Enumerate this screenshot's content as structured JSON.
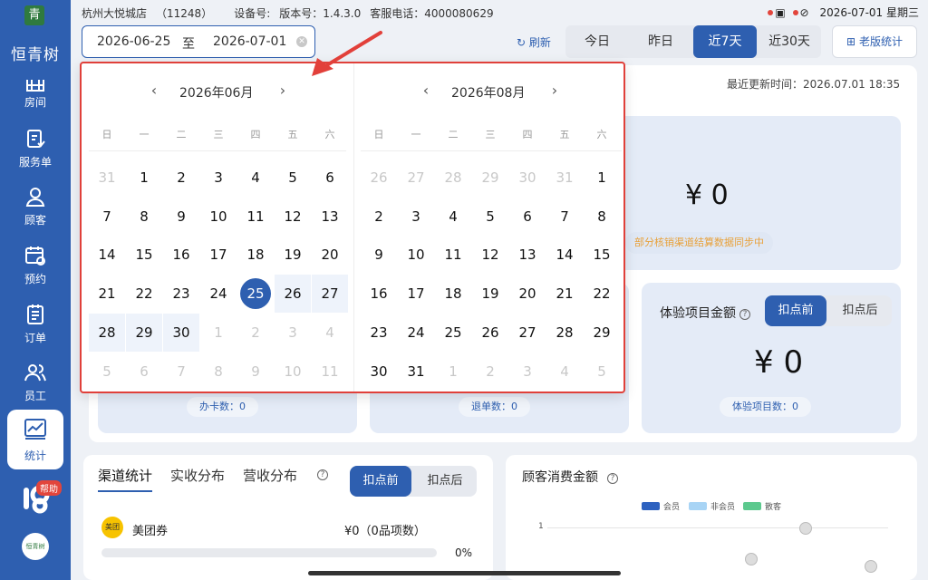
{
  "sidebar": {
    "brand_logo": "青",
    "brand_name": "恒青树",
    "items": [
      {
        "label": "房间",
        "icon": "room-icon"
      },
      {
        "label": "服务单",
        "icon": "service-order-icon"
      },
      {
        "label": "顾客",
        "icon": "customer-icon"
      },
      {
        "label": "预约",
        "icon": "appointment-icon"
      },
      {
        "label": "订单",
        "icon": "order-icon"
      },
      {
        "label": "员工",
        "icon": "staff-icon"
      },
      {
        "label": "统计",
        "icon": "statistics-icon",
        "active": true
      }
    ],
    "help_badge": "帮助",
    "avatar_text": "恒青树"
  },
  "topbar": {
    "store": "杭州大悦城店",
    "store_id": "（11248）",
    "device_label": "设备号:",
    "version": "版本号：1.4.3.0",
    "service_phone": "客服电话：4000080629",
    "datetime": "2026-07-01 星期三"
  },
  "date_range": {
    "start": "2026-06-25",
    "separator": "至",
    "end": "2026-07-01"
  },
  "toolbar": {
    "refresh": "刷新",
    "ranges": [
      "今日",
      "昨日",
      "近7天",
      "近30天"
    ],
    "active_range": "近7天",
    "boss_stats": "老版统计"
  },
  "overview": {
    "update_time": "最近更新时间：2026.07.01 18:35",
    "amount_top": "¥ 0",
    "sync_tip": "部分核销渠道结算数据同步中",
    "experience_title": "体验项目金额",
    "toggle": [
      "扣点前",
      "扣点后"
    ],
    "experience_amount": "¥ 0",
    "card_count_pill": "办卡数：0",
    "refund_count_pill": "退单数：0",
    "experience_count_pill": "体验项目数：0"
  },
  "channel": {
    "tabs": [
      "渠道统计",
      "实收分布",
      "营收分布"
    ],
    "toggle": [
      "扣点前",
      "扣点后"
    ],
    "rows": [
      {
        "logo": "美团",
        "name": "美团券",
        "amount": "¥0（0品项数）",
        "percent": "0%",
        "progress": 0
      }
    ]
  },
  "customer_spend": {
    "title": "顾客消费金额",
    "legend": [
      {
        "name": "会员",
        "color": "#2e62c0"
      },
      {
        "name": "非会员",
        "color": "#a8d4f5"
      },
      {
        "name": "散客",
        "color": "#5cc98e"
      }
    ],
    "y_label_1": "1"
  },
  "calendar": {
    "weekdays": [
      "日",
      "一",
      "二",
      "三",
      "四",
      "五",
      "六"
    ],
    "left": {
      "title": "2026年06月",
      "days": [
        [
          "31",
          "muted"
        ],
        [
          "1",
          ""
        ],
        [
          "2",
          ""
        ],
        [
          "3",
          ""
        ],
        [
          "4",
          ""
        ],
        [
          "5",
          ""
        ],
        [
          "6",
          ""
        ],
        [
          "7",
          ""
        ],
        [
          "8",
          ""
        ],
        [
          "9",
          ""
        ],
        [
          "10",
          ""
        ],
        [
          "11",
          ""
        ],
        [
          "12",
          ""
        ],
        [
          "13",
          ""
        ],
        [
          "14",
          ""
        ],
        [
          "15",
          ""
        ],
        [
          "16",
          ""
        ],
        [
          "17",
          ""
        ],
        [
          "18",
          ""
        ],
        [
          "19",
          ""
        ],
        [
          "20",
          ""
        ],
        [
          "21",
          ""
        ],
        [
          "22",
          ""
        ],
        [
          "23",
          ""
        ],
        [
          "24",
          ""
        ],
        [
          "25",
          "sel"
        ],
        [
          "26",
          "inrange"
        ],
        [
          "27",
          "inrange"
        ],
        [
          "28",
          "inrange"
        ],
        [
          "29",
          "inrange"
        ],
        [
          "30",
          "inrange"
        ],
        [
          "1",
          "muted"
        ],
        [
          "2",
          "muted"
        ],
        [
          "3",
          "muted"
        ],
        [
          "4",
          "muted"
        ],
        [
          "5",
          "muted"
        ],
        [
          "6",
          "muted"
        ],
        [
          "7",
          "muted"
        ],
        [
          "8",
          "muted"
        ],
        [
          "9",
          "muted"
        ],
        [
          "10",
          "muted"
        ],
        [
          "11",
          "muted"
        ]
      ]
    },
    "right": {
      "title": "2026年08月",
      "days": [
        [
          "26",
          "muted"
        ],
        [
          "27",
          "muted"
        ],
        [
          "28",
          "muted"
        ],
        [
          "29",
          "muted"
        ],
        [
          "30",
          "muted"
        ],
        [
          "31",
          "muted"
        ],
        [
          "1",
          ""
        ],
        [
          "2",
          ""
        ],
        [
          "3",
          ""
        ],
        [
          "4",
          ""
        ],
        [
          "5",
          ""
        ],
        [
          "6",
          ""
        ],
        [
          "7",
          ""
        ],
        [
          "8",
          ""
        ],
        [
          "9",
          ""
        ],
        [
          "10",
          ""
        ],
        [
          "11",
          ""
        ],
        [
          "12",
          ""
        ],
        [
          "13",
          ""
        ],
        [
          "14",
          ""
        ],
        [
          "15",
          ""
        ],
        [
          "16",
          ""
        ],
        [
          "17",
          ""
        ],
        [
          "18",
          ""
        ],
        [
          "19",
          ""
        ],
        [
          "20",
          ""
        ],
        [
          "21",
          ""
        ],
        [
          "22",
          ""
        ],
        [
          "23",
          ""
        ],
        [
          "24",
          ""
        ],
        [
          "25",
          ""
        ],
        [
          "26",
          ""
        ],
        [
          "27",
          ""
        ],
        [
          "28",
          ""
        ],
        [
          "29",
          ""
        ],
        [
          "30",
          ""
        ],
        [
          "31",
          ""
        ],
        [
          "1",
          "muted"
        ],
        [
          "2",
          "muted"
        ],
        [
          "3",
          "muted"
        ],
        [
          "4",
          "muted"
        ],
        [
          "5",
          "muted"
        ]
      ]
    }
  }
}
